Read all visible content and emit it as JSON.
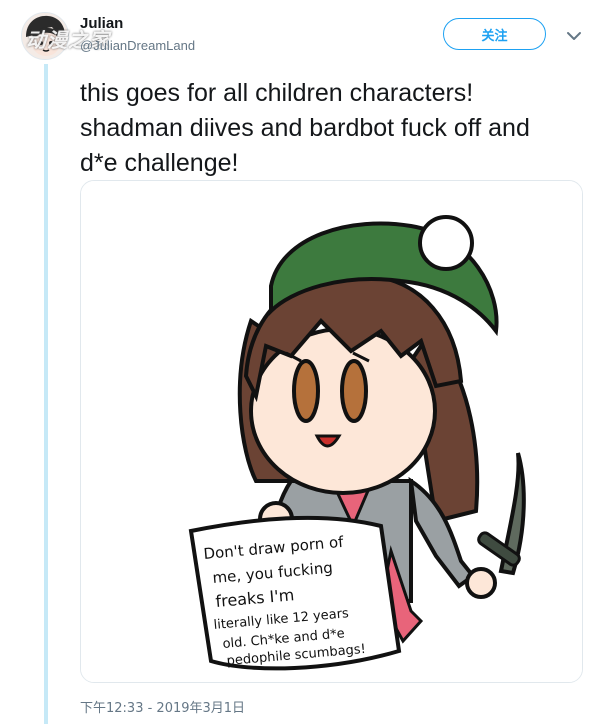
{
  "tweet": {
    "author_name": "Julian",
    "author_handle": "@JulianDreamLand",
    "follow_label": "关注",
    "text": "this goes for all children characters!\nshadman diives and bardbot fuck off and\nd*e challenge!",
    "timestamp": "下午12:33 - 2019年3月1日"
  },
  "watermark": "动漫之家",
  "image": {
    "sign_lines": [
      "Don't draw porn of",
      "me, you fucking",
      "freaks I'm",
      "literally like 12 years",
      "old. Ch*ke and d*e",
      "pedophile scumbags!"
    ]
  },
  "icons": {
    "menu": "chevron-down-icon"
  },
  "colors": {
    "accent": "#1da1f2",
    "thread_line": "#c6e9f7",
    "hat": "#3d7a3e",
    "hair": "#6b4334",
    "coat": "#9aa0a3",
    "dress": "#e8647a"
  }
}
